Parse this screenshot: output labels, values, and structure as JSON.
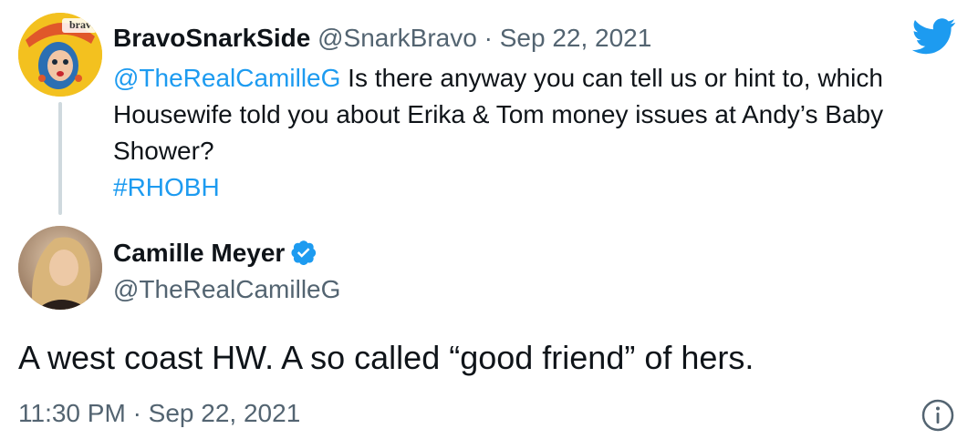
{
  "reply_tweet": {
    "display_name": "BravoSnarkSide",
    "handle": "@SnarkBravo",
    "separator": "·",
    "date": "Sep 22, 2021",
    "mention": "@TheRealCamilleG",
    "body": " Is there anyway you can tell us or hint to, which Housewife told you about Erika & Tom money issues at Andy’s Baby Shower?",
    "hashtag": "#RHOBH",
    "avatar_icon": "cartoon-woman-avatar",
    "avatar_logo_text": "bravo"
  },
  "main_tweet": {
    "display_name": "Camille Meyer",
    "verified_icon": "verified-badge-icon",
    "handle": "@TheRealCamilleG",
    "body": "A west coast HW.  A so called “good friend” of hers.",
    "time": "11:30 PM",
    "separator": "·",
    "date": "Sep 22, 2021",
    "avatar_icon": "photo-woman-avatar"
  },
  "icons": {
    "brand": "twitter-bird-icon",
    "info": "info-icon"
  },
  "colors": {
    "link": "#1d9bf0",
    "text": "#0f1419",
    "secondary": "#536471",
    "thread_line": "#cfd9de",
    "verified": "#1d9bf0"
  }
}
